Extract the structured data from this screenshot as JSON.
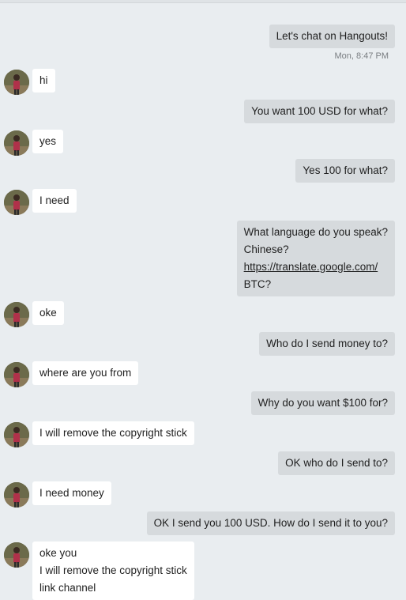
{
  "conversation": {
    "messages": [
      {
        "from": "me",
        "lines": [
          "Let's chat on Hangouts!"
        ]
      },
      {
        "from": "me",
        "timestamp": "Mon, 8:47 PM"
      },
      {
        "from": "them",
        "lines": [
          "hi"
        ]
      },
      {
        "from": "me",
        "lines": [
          "You want 100 USD for what?"
        ]
      },
      {
        "from": "them",
        "lines": [
          "yes"
        ]
      },
      {
        "from": "me",
        "lines": [
          "Yes 100 for what?"
        ]
      },
      {
        "from": "them",
        "lines": [
          "I need"
        ]
      },
      {
        "from": "me",
        "lines": [
          "What language do you speak?",
          "Chinese?",
          "https://translate.google.com/",
          "BTC?"
        ]
      },
      {
        "from": "them",
        "lines": [
          "oke"
        ]
      },
      {
        "from": "me",
        "lines": [
          "Who do I send money to?"
        ]
      },
      {
        "from": "them",
        "lines": [
          "where are you from"
        ]
      },
      {
        "from": "me",
        "lines": [
          "Why do you want $100 for?"
        ]
      },
      {
        "from": "them",
        "lines": [
          "I will remove the copyright stick"
        ]
      },
      {
        "from": "me",
        "lines": [
          "OK who do I send to?"
        ]
      },
      {
        "from": "them",
        "lines": [
          "I need money"
        ]
      },
      {
        "from": "me",
        "lines": [
          "OK I send you 100 USD. How do I send it to you?"
        ]
      },
      {
        "from": "them",
        "lines": [
          "oke you",
          "I will remove the copyright stick",
          "link channel"
        ]
      }
    ]
  },
  "avatar": {
    "icon": "contact-avatar-icon"
  },
  "colors": {
    "background": "#e9edf0",
    "outgoing_bubble": "#d6dadd",
    "incoming_bubble": "#ffffff",
    "timestamp_text": "#7a7e82"
  }
}
